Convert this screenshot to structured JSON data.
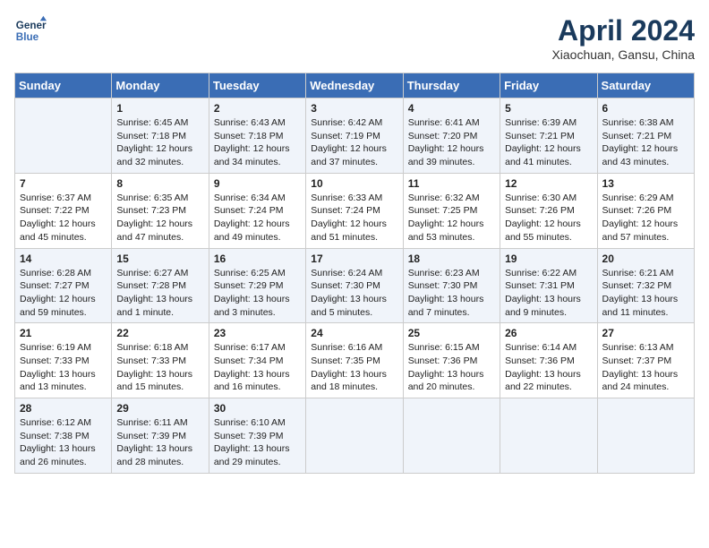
{
  "header": {
    "logo_line1": "General",
    "logo_line2": "Blue",
    "month_year": "April 2024",
    "location": "Xiaochuan, Gansu, China"
  },
  "days_of_week": [
    "Sunday",
    "Monday",
    "Tuesday",
    "Wednesday",
    "Thursday",
    "Friday",
    "Saturday"
  ],
  "weeks": [
    [
      {
        "day": "",
        "content": ""
      },
      {
        "day": "1",
        "content": "Sunrise: 6:45 AM\nSunset: 7:18 PM\nDaylight: 12 hours\nand 32 minutes."
      },
      {
        "day": "2",
        "content": "Sunrise: 6:43 AM\nSunset: 7:18 PM\nDaylight: 12 hours\nand 34 minutes."
      },
      {
        "day": "3",
        "content": "Sunrise: 6:42 AM\nSunset: 7:19 PM\nDaylight: 12 hours\nand 37 minutes."
      },
      {
        "day": "4",
        "content": "Sunrise: 6:41 AM\nSunset: 7:20 PM\nDaylight: 12 hours\nand 39 minutes."
      },
      {
        "day": "5",
        "content": "Sunrise: 6:39 AM\nSunset: 7:21 PM\nDaylight: 12 hours\nand 41 minutes."
      },
      {
        "day": "6",
        "content": "Sunrise: 6:38 AM\nSunset: 7:21 PM\nDaylight: 12 hours\nand 43 minutes."
      }
    ],
    [
      {
        "day": "7",
        "content": "Sunrise: 6:37 AM\nSunset: 7:22 PM\nDaylight: 12 hours\nand 45 minutes."
      },
      {
        "day": "8",
        "content": "Sunrise: 6:35 AM\nSunset: 7:23 PM\nDaylight: 12 hours\nand 47 minutes."
      },
      {
        "day": "9",
        "content": "Sunrise: 6:34 AM\nSunset: 7:24 PM\nDaylight: 12 hours\nand 49 minutes."
      },
      {
        "day": "10",
        "content": "Sunrise: 6:33 AM\nSunset: 7:24 PM\nDaylight: 12 hours\nand 51 minutes."
      },
      {
        "day": "11",
        "content": "Sunrise: 6:32 AM\nSunset: 7:25 PM\nDaylight: 12 hours\nand 53 minutes."
      },
      {
        "day": "12",
        "content": "Sunrise: 6:30 AM\nSunset: 7:26 PM\nDaylight: 12 hours\nand 55 minutes."
      },
      {
        "day": "13",
        "content": "Sunrise: 6:29 AM\nSunset: 7:26 PM\nDaylight: 12 hours\nand 57 minutes."
      }
    ],
    [
      {
        "day": "14",
        "content": "Sunrise: 6:28 AM\nSunset: 7:27 PM\nDaylight: 12 hours\nand 59 minutes."
      },
      {
        "day": "15",
        "content": "Sunrise: 6:27 AM\nSunset: 7:28 PM\nDaylight: 13 hours\nand 1 minute."
      },
      {
        "day": "16",
        "content": "Sunrise: 6:25 AM\nSunset: 7:29 PM\nDaylight: 13 hours\nand 3 minutes."
      },
      {
        "day": "17",
        "content": "Sunrise: 6:24 AM\nSunset: 7:30 PM\nDaylight: 13 hours\nand 5 minutes."
      },
      {
        "day": "18",
        "content": "Sunrise: 6:23 AM\nSunset: 7:30 PM\nDaylight: 13 hours\nand 7 minutes."
      },
      {
        "day": "19",
        "content": "Sunrise: 6:22 AM\nSunset: 7:31 PM\nDaylight: 13 hours\nand 9 minutes."
      },
      {
        "day": "20",
        "content": "Sunrise: 6:21 AM\nSunset: 7:32 PM\nDaylight: 13 hours\nand 11 minutes."
      }
    ],
    [
      {
        "day": "21",
        "content": "Sunrise: 6:19 AM\nSunset: 7:33 PM\nDaylight: 13 hours\nand 13 minutes."
      },
      {
        "day": "22",
        "content": "Sunrise: 6:18 AM\nSunset: 7:33 PM\nDaylight: 13 hours\nand 15 minutes."
      },
      {
        "day": "23",
        "content": "Sunrise: 6:17 AM\nSunset: 7:34 PM\nDaylight: 13 hours\nand 16 minutes."
      },
      {
        "day": "24",
        "content": "Sunrise: 6:16 AM\nSunset: 7:35 PM\nDaylight: 13 hours\nand 18 minutes."
      },
      {
        "day": "25",
        "content": "Sunrise: 6:15 AM\nSunset: 7:36 PM\nDaylight: 13 hours\nand 20 minutes."
      },
      {
        "day": "26",
        "content": "Sunrise: 6:14 AM\nSunset: 7:36 PM\nDaylight: 13 hours\nand 22 minutes."
      },
      {
        "day": "27",
        "content": "Sunrise: 6:13 AM\nSunset: 7:37 PM\nDaylight: 13 hours\nand 24 minutes."
      }
    ],
    [
      {
        "day": "28",
        "content": "Sunrise: 6:12 AM\nSunset: 7:38 PM\nDaylight: 13 hours\nand 26 minutes."
      },
      {
        "day": "29",
        "content": "Sunrise: 6:11 AM\nSunset: 7:39 PM\nDaylight: 13 hours\nand 28 minutes."
      },
      {
        "day": "30",
        "content": "Sunrise: 6:10 AM\nSunset: 7:39 PM\nDaylight: 13 hours\nand 29 minutes."
      },
      {
        "day": "",
        "content": ""
      },
      {
        "day": "",
        "content": ""
      },
      {
        "day": "",
        "content": ""
      },
      {
        "day": "",
        "content": ""
      }
    ]
  ]
}
